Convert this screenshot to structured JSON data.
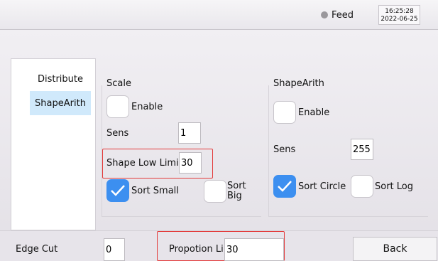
{
  "header": {
    "feed_label": "Feed",
    "time": "16:25:28",
    "date": "2022-06-25"
  },
  "nav": {
    "items": [
      {
        "label": "Distribute"
      },
      {
        "label": "ShapeArith"
      }
    ]
  },
  "scale": {
    "title": "Scale",
    "enable_label": "Enable",
    "sens_label": "Sens",
    "sens_value": "1",
    "shape_low_limit_label": "Shape Low Limit",
    "shape_low_limit_value": "30",
    "sort_small_label": "Sort Small",
    "sort_small_checked": true,
    "sort_big_label_1": "Sort",
    "sort_big_label_2": "Big",
    "sort_big_checked": false
  },
  "shapearith": {
    "title": "ShapeArith",
    "enable_label": "Enable",
    "sens_label": "Sens",
    "sens_value": "255",
    "sort_circle_label": "Sort Circle",
    "sort_circle_checked": true,
    "sort_log_label": "Sort Log",
    "sort_log_checked": false
  },
  "footer": {
    "edge_cut_label": "Edge Cut",
    "edge_cut_value": "0",
    "proportion_label": "Propotion Li",
    "proportion_value": "30",
    "back_label": "Back"
  },
  "colors": {
    "accent": "#3c8ff0",
    "highlight": "#e33b3b",
    "nav_active": "#d0e9fb"
  }
}
